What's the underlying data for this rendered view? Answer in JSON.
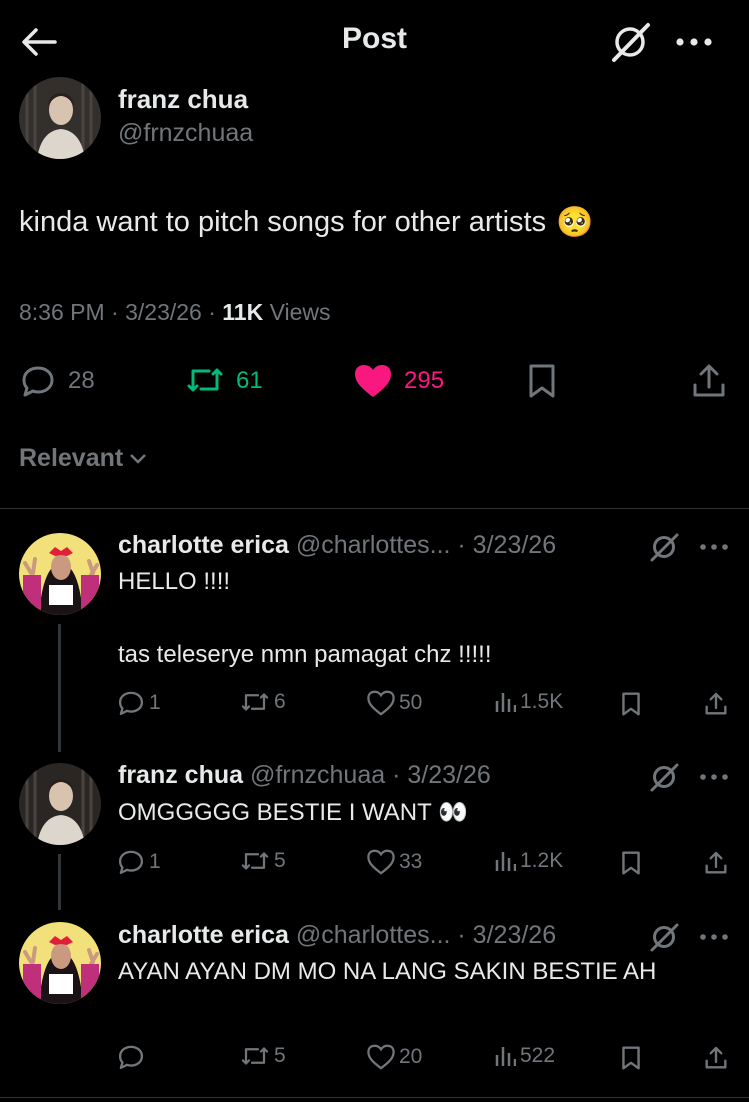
{
  "header": {
    "title": "Post"
  },
  "post": {
    "name": "franz chua",
    "handle": "@frnzchuaa",
    "text": "kinda want to pitch songs for other artists",
    "emoji": "🥺",
    "time": "8:36 PM · 3/23/26 · ",
    "views_count": "11K",
    "views_label": " Views",
    "replies": "28",
    "reposts": "61",
    "likes": "295"
  },
  "sort": {
    "label": "Relevant"
  },
  "replies": [
    {
      "name": "charlotte erica",
      "handle_date": " @charlottes... · 3/23/26",
      "line1": "HELLO !!!!",
      "line2": "tas teleserye nmn pamagat chz !!!!!",
      "replies": "1",
      "reposts": "6",
      "likes": "50",
      "views": "1.5K"
    },
    {
      "name": "franz chua",
      "handle_date": " @frnzchuaa · 3/23/26",
      "line1": "OMGGGGG BESTIE I WANT",
      "emoji": "👀",
      "replies": "1",
      "reposts": "5",
      "likes": "33",
      "views": "1.2K"
    },
    {
      "name": "charlotte erica",
      "handle_date": " @charlottes... · 3/23/26",
      "line1": "AYAN AYAN DM MO NA LANG SAKIN BESTIE AH",
      "replies": "",
      "reposts": "5",
      "likes": "20",
      "views": "522"
    }
  ],
  "colors": {
    "background": "#000000",
    "text": "#e7e9ea",
    "muted": "#71767b",
    "repost": "#00ba7c",
    "like": "#f91880"
  }
}
